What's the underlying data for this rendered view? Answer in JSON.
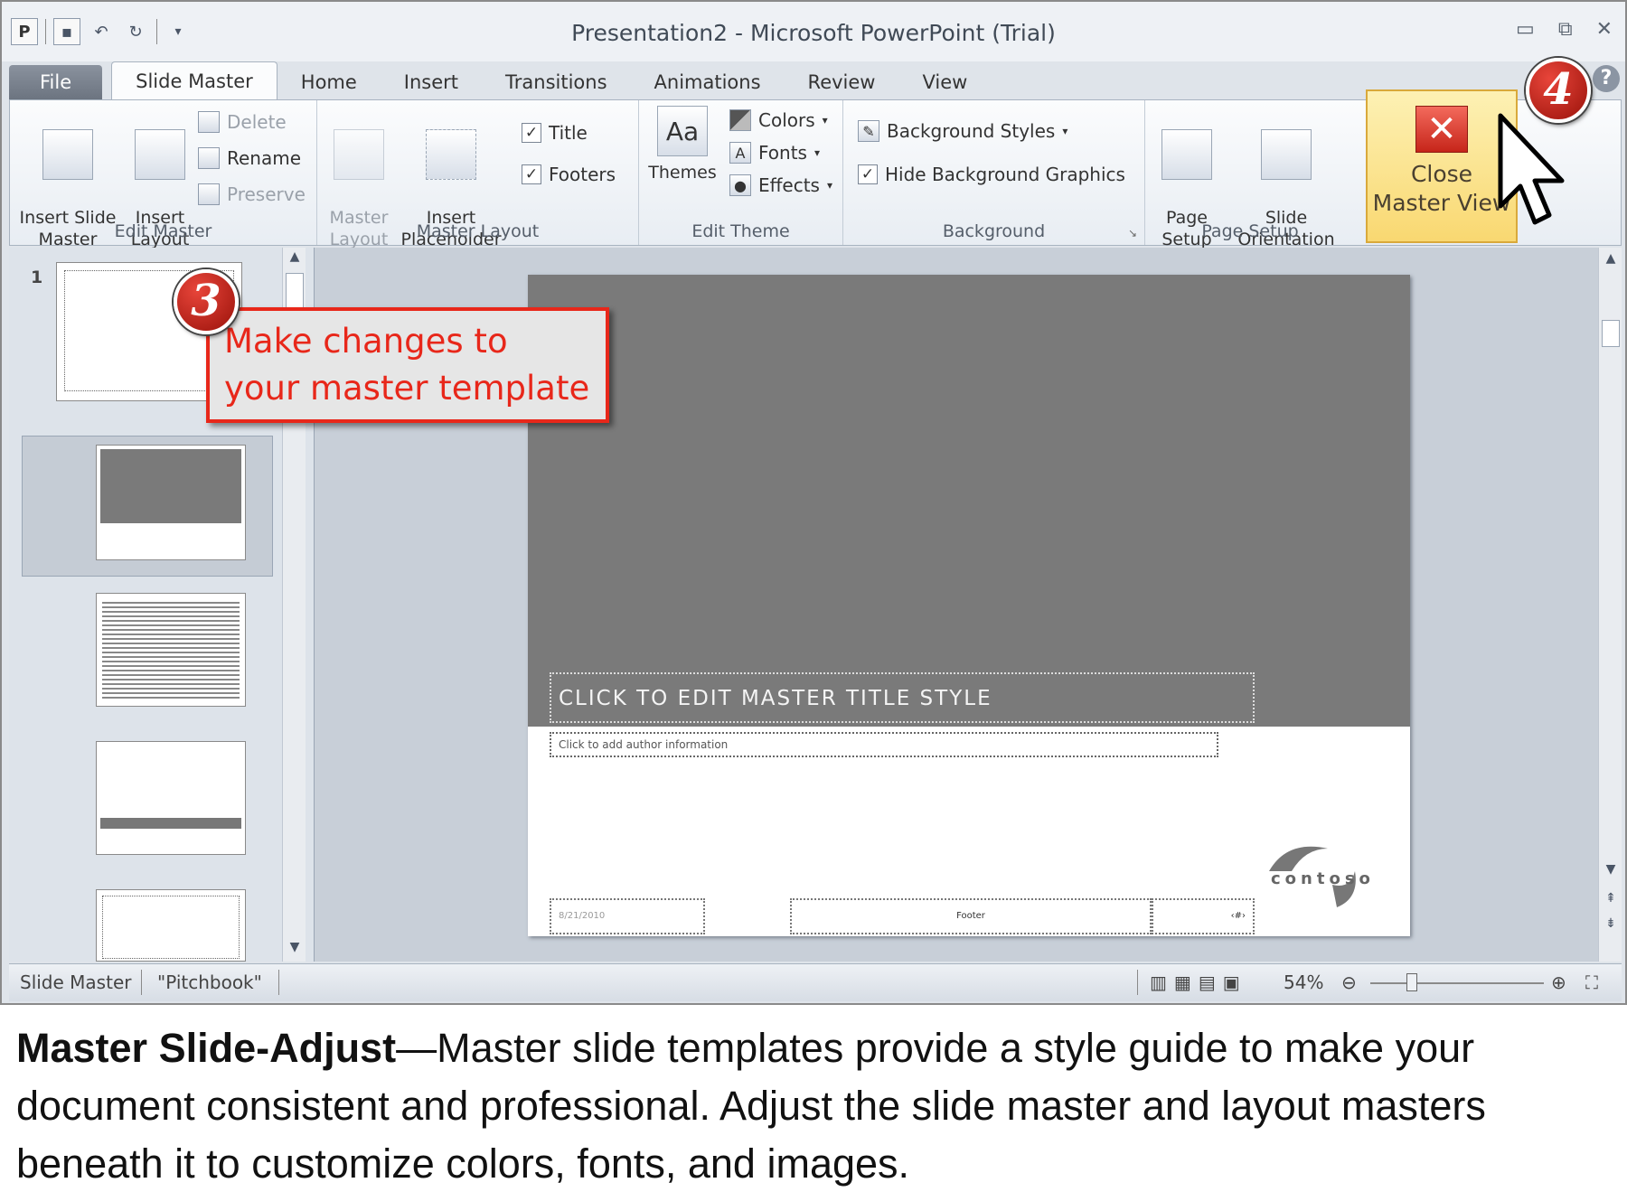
{
  "window": {
    "title": "Presentation2  -  Microsoft PowerPoint (Trial)"
  },
  "tabs": [
    "File",
    "Slide Master",
    "Home",
    "Insert",
    "Transitions",
    "Animations",
    "Review",
    "View"
  ],
  "ribbon": {
    "edit_master": {
      "label": "Edit Master",
      "insert_slide_master": "Insert Slide\nMaster",
      "insert_layout": "Insert\nLayout",
      "delete": "Delete",
      "rename": "Rename",
      "preserve": "Preserve"
    },
    "master_layout": {
      "label": "Master Layout",
      "master_layout": "Master\nLayout",
      "insert_placeholder": "Insert\nPlaceholder",
      "title": "Title",
      "footers": "Footers"
    },
    "edit_theme": {
      "label": "Edit Theme",
      "themes": "Themes",
      "colors": "Colors",
      "fonts": "Fonts",
      "effects": "Effects"
    },
    "background": {
      "label": "Background",
      "background_styles": "Background Styles",
      "hide_background_graphics": "Hide Background Graphics"
    },
    "page_setup": {
      "label": "Page Setup",
      "page_setup": "Page\nSetup",
      "slide_orientation": "Slide\nOrientation"
    },
    "close": {
      "label": "Close\nMaster View"
    }
  },
  "thumbnails": {
    "first_number": "1"
  },
  "slide": {
    "title_placeholder": "CLICK TO EDIT MASTER TITLE STYLE",
    "author_placeholder": "Click to add author information",
    "date": "8/21/2010",
    "footer": "Footer",
    "slide_number": "‹#›",
    "logo": "contoso"
  },
  "statusbar": {
    "view": "Slide Master",
    "theme": "\"Pitchbook\"",
    "zoom": "54%"
  },
  "callouts": {
    "step3_badge": "3",
    "step3_text": "Make changes to your master template",
    "step4_badge": "4"
  },
  "caption": {
    "bold": "Master Slide-Adjust",
    "rest": "—Master slide templates provide a style guide to make your document consistent and professional.  Adjust the slide master and layout masters beneath it to customize colors, fonts, and images."
  }
}
